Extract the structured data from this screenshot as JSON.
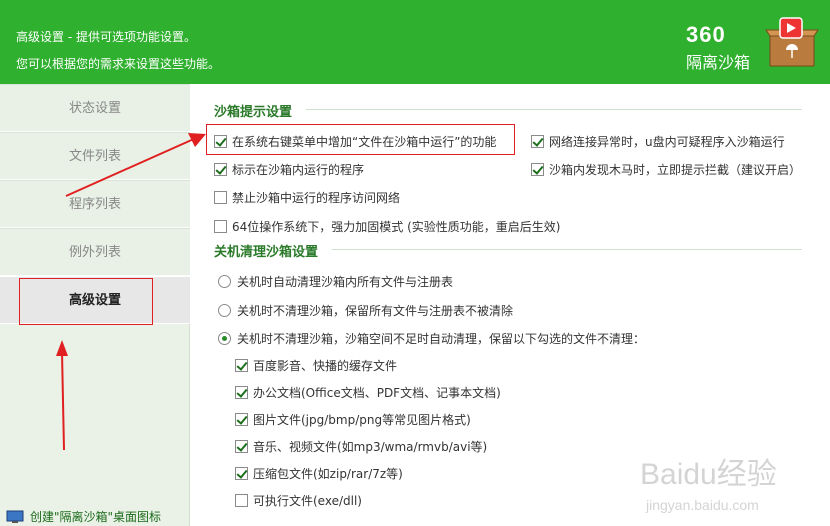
{
  "header": {
    "line1": "高级设置 - 提供可选项功能设置。",
    "line2": "您可以根据您的需求来设置这些功能。",
    "brand_number": "360",
    "brand_name": "隔离沙箱",
    "bg_color": "#2fb02f"
  },
  "sidebar": {
    "items": [
      {
        "label": "状态设置",
        "active": false
      },
      {
        "label": "文件列表",
        "active": false
      },
      {
        "label": "程序列表",
        "active": false
      },
      {
        "label": "例外列表",
        "active": false
      },
      {
        "label": "高级设置",
        "active": true
      }
    ],
    "bottom_link": "创建\"隔离沙箱\"桌面图标"
  },
  "sandbox_hint": {
    "title": "沙箱提示设置",
    "options": [
      {
        "label": "在系统右键菜单中增加“文件在沙箱中运行”的功能",
        "checked": true
      },
      {
        "label": "网络连接异常时，u盘内可疑程序入沙箱运行",
        "checked": true
      },
      {
        "label": "标示在沙箱内运行的程序",
        "checked": true
      },
      {
        "label": "沙箱内发现木马时，立即提示拦截（建议开启）",
        "checked": true
      },
      {
        "label": "禁止沙箱中运行的程序访问网络",
        "checked": false
      },
      {
        "label": "64位操作系统下，强力加固模式 (实验性质功能，重启后生效)",
        "checked": false
      }
    ]
  },
  "shutdown_clean": {
    "title": "关机清理沙箱设置",
    "radios": [
      {
        "label": "关机时自动清理沙箱内所有文件与注册表",
        "selected": false
      },
      {
        "label": "关机时不清理沙箱，保留所有文件与注册表不被清除",
        "selected": false
      },
      {
        "label": "关机时不清理沙箱，沙箱空间不足时自动清理，保留以下勾选的文件不清理：",
        "selected": true
      }
    ],
    "keep_files": [
      {
        "label": "百度影音、快播的缓存文件",
        "checked": true
      },
      {
        "label": "办公文档(Office文档、PDF文档、记事本文档)",
        "checked": true
      },
      {
        "label": "图片文件(jpg/bmp/png等常见图片格式)",
        "checked": true
      },
      {
        "label": "音乐、视频文件(如mp3/wma/rmvb/avi等)",
        "checked": true
      },
      {
        "label": "压缩包文件(如zip/rar/7z等)",
        "checked": true
      },
      {
        "label": "可执行文件(exe/dll)",
        "checked": false
      }
    ]
  },
  "watermark": {
    "brand": "Baidu经验",
    "url": "jingyan.baidu.com"
  },
  "annotation_color": "#e02020"
}
